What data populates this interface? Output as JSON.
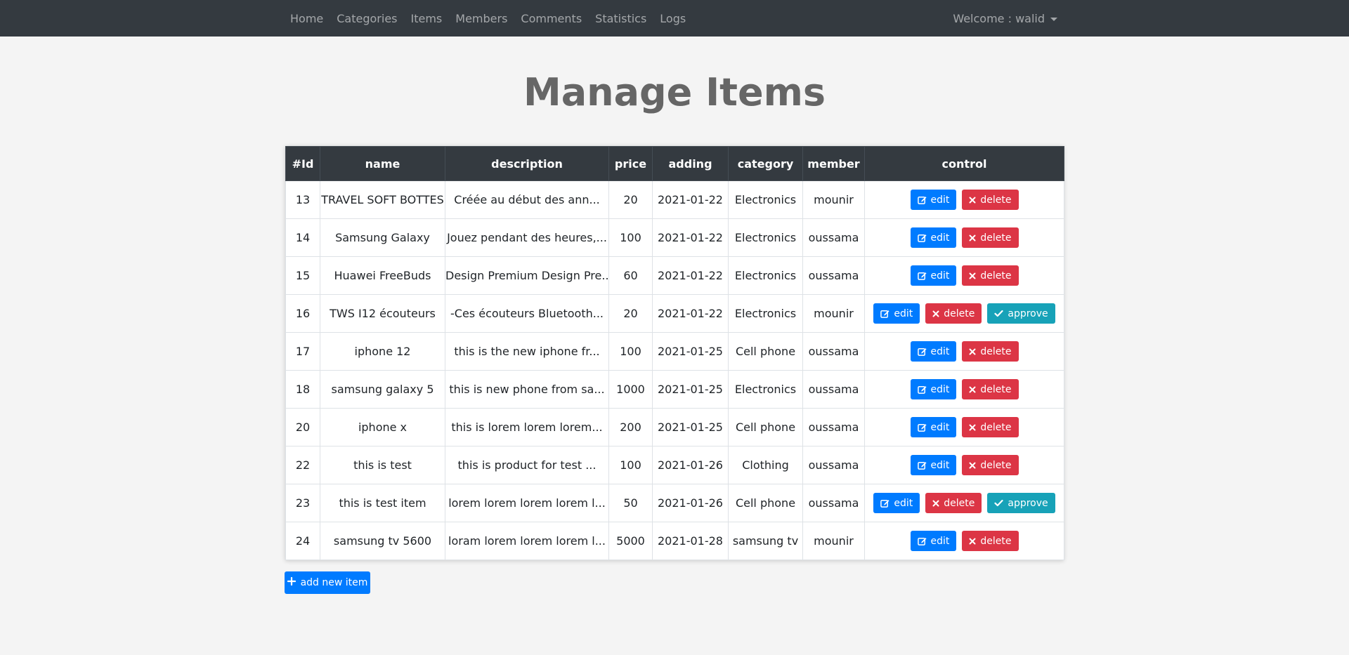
{
  "nav": {
    "links": [
      "Home",
      "Categories",
      "Items",
      "Members",
      "Comments",
      "Statistics",
      "Logs"
    ],
    "user_label": "Welcome : walid"
  },
  "page": {
    "title": "Manage Items"
  },
  "table": {
    "headers": [
      "#Id",
      "name",
      "description",
      "price",
      "adding",
      "category",
      "member",
      "control"
    ],
    "rows": [
      {
        "id": "13",
        "name": "TRAVEL SOFT BOTTES",
        "description": "Créée au début des ann...",
        "price": "20",
        "adding": "2021-01-22",
        "category": "Electronics",
        "member": "mounir",
        "approve": false
      },
      {
        "id": "14",
        "name": "Samsung Galaxy",
        "description": "Jouez pendant des heures,...",
        "price": "100",
        "adding": "2021-01-22",
        "category": "Electronics",
        "member": "oussama",
        "approve": false
      },
      {
        "id": "15",
        "name": "Huawei FreeBuds",
        "description": "Design Premium Design Pre...",
        "price": "60",
        "adding": "2021-01-22",
        "category": "Electronics",
        "member": "oussama",
        "approve": false
      },
      {
        "id": "16",
        "name": "TWS I12 écouteurs",
        "description": "-Ces écouteurs Bluetooth...",
        "price": "20",
        "adding": "2021-01-22",
        "category": "Electronics",
        "member": "mounir",
        "approve": true
      },
      {
        "id": "17",
        "name": "iphone 12",
        "description": "this is the new iphone fr...",
        "price": "100",
        "adding": "2021-01-25",
        "category": "Cell phone",
        "member": "oussama",
        "approve": false
      },
      {
        "id": "18",
        "name": "samsung galaxy 5",
        "description": "this is new phone from sa...",
        "price": "1000",
        "adding": "2021-01-25",
        "category": "Electronics",
        "member": "oussama",
        "approve": false
      },
      {
        "id": "20",
        "name": "iphone x",
        "description": "this is lorem lorem lorem...",
        "price": "200",
        "adding": "2021-01-25",
        "category": "Cell phone",
        "member": "oussama",
        "approve": false
      },
      {
        "id": "22",
        "name": "this is test",
        "description": "this is product for test ...",
        "price": "100",
        "adding": "2021-01-26",
        "category": "Clothing",
        "member": "oussama",
        "approve": false
      },
      {
        "id": "23",
        "name": "this is test item",
        "description": "lorem lorem lorem lorem l...",
        "price": "50",
        "adding": "2021-01-26",
        "category": "Cell phone",
        "member": "oussama",
        "approve": true
      },
      {
        "id": "24",
        "name": "samsung tv 5600",
        "description": "loram lorem lorem lorem l...",
        "price": "5000",
        "adding": "2021-01-28",
        "category": "samsung tv",
        "member": "mounir",
        "approve": false
      }
    ],
    "buttons": {
      "edit": "edit",
      "delete": "delete",
      "approve": "approve"
    }
  },
  "add_button": {
    "label": "add new item"
  },
  "colors": {
    "navbar": "#343a40",
    "primary": "#007bff",
    "danger": "#dc3545",
    "info": "#17a2b8"
  },
  "icons": {
    "edit": "edit-icon",
    "delete": "x-icon",
    "approve": "check-icon",
    "add": "plus-icon",
    "user_menu": "caret-down-icon"
  }
}
